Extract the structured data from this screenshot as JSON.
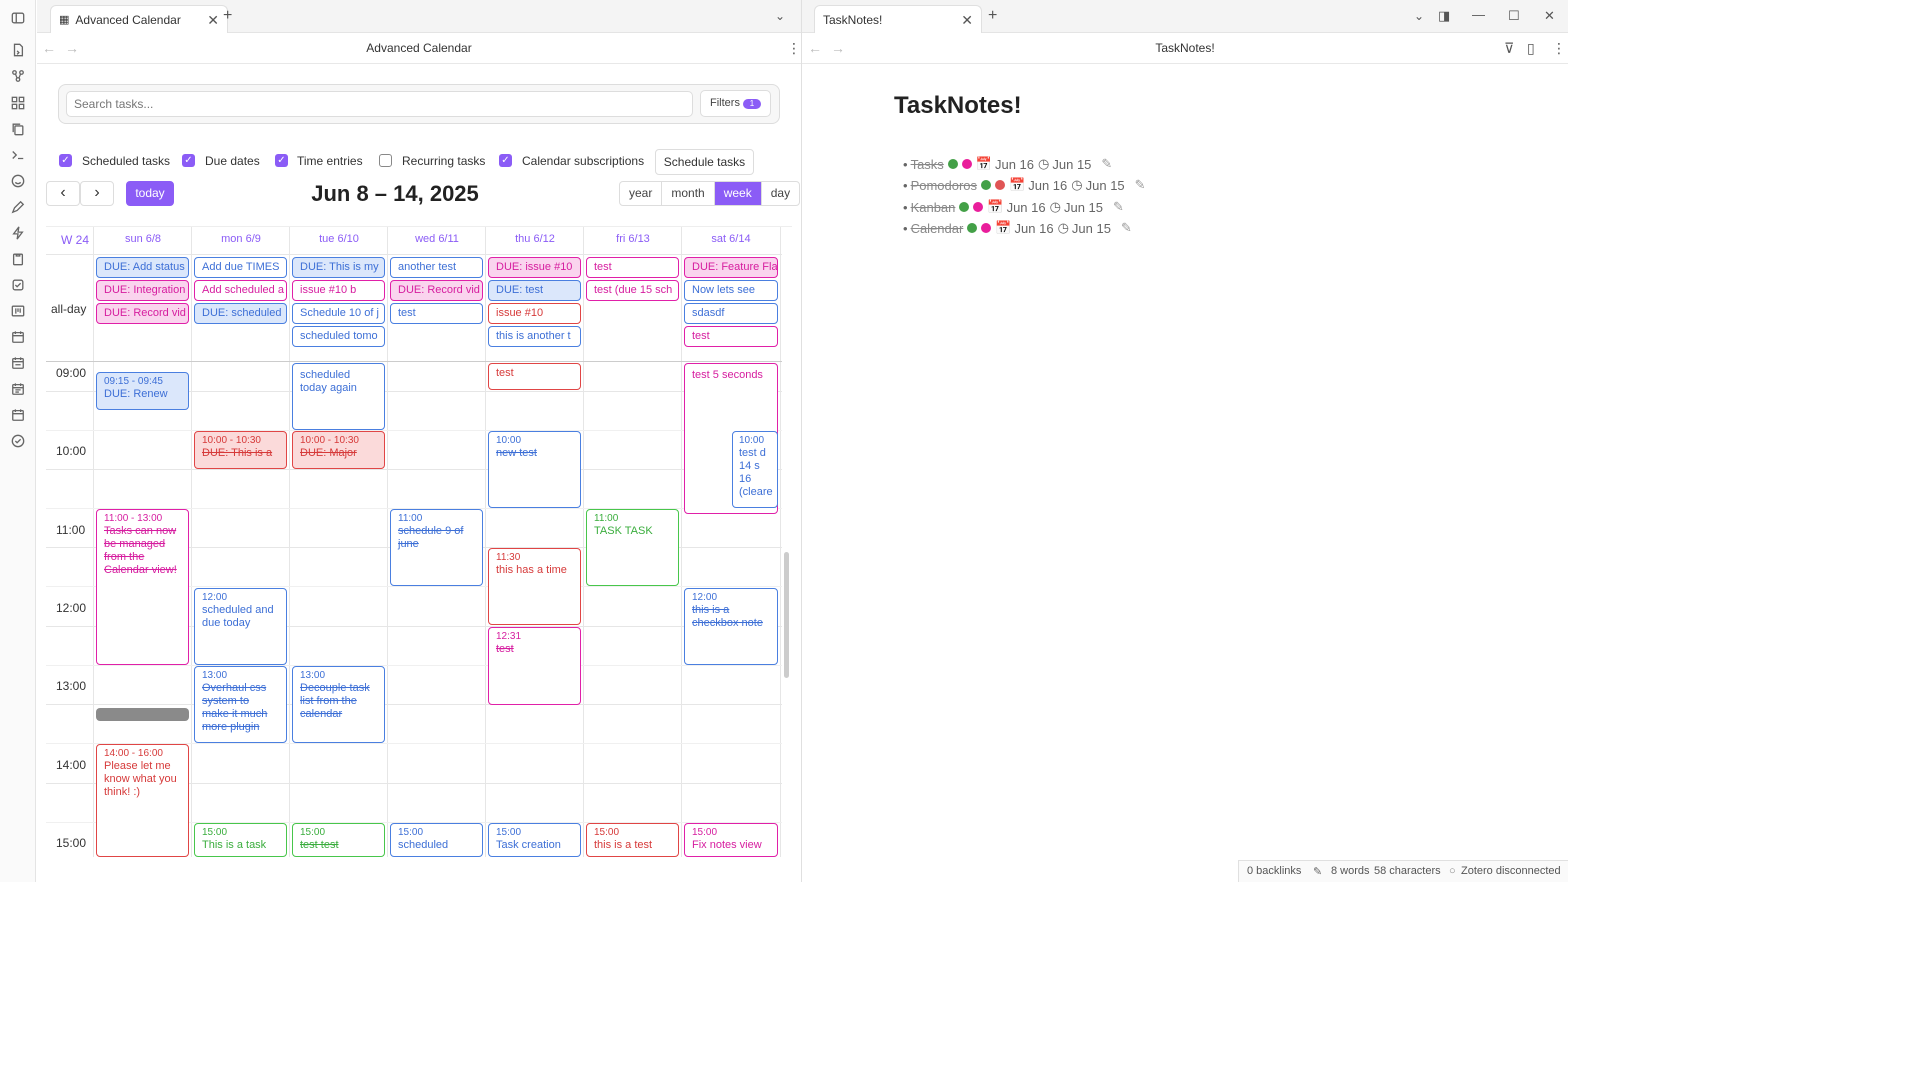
{
  "left_tab": {
    "title": "Advanced Calendar",
    "view_title": "Advanced Calendar"
  },
  "right_tab": {
    "title": "TaskNotes!",
    "view_title": "TaskNotes!"
  },
  "search": {
    "placeholder": "Search tasks..."
  },
  "filters": {
    "label": "Filters",
    "count": "1"
  },
  "toggles": [
    {
      "label": "Scheduled tasks",
      "checked": true
    },
    {
      "label": "Due dates",
      "checked": true
    },
    {
      "label": "Time entries",
      "checked": true
    },
    {
      "label": "Recurring tasks",
      "checked": false
    },
    {
      "label": "Calendar subscriptions",
      "checked": true
    }
  ],
  "schedule_button": "Schedule tasks",
  "nav": {
    "prev": "‹",
    "next": "›",
    "today": "today"
  },
  "calendar_title": "Jun 8 – 14, 2025",
  "views": [
    "year",
    "month",
    "week",
    "day"
  ],
  "active_view": "week",
  "week_label": "W 24",
  "allday_label": "all-day",
  "days": [
    "sun 6/8",
    "mon 6/9",
    "tue 6/10",
    "wed 6/11",
    "thu 6/12",
    "fri 6/13",
    "sat 6/14"
  ],
  "hours": [
    "09:00",
    "10:00",
    "11:00",
    "12:00",
    "13:00",
    "14:00",
    "15:00"
  ],
  "allday_events": [
    [
      "DUE: Add status",
      "DUE: Integration",
      "DUE: Record vid"
    ],
    [
      "Add due TIMES",
      "Add scheduled a",
      "DUE: scheduled"
    ],
    [
      "DUE: This is my",
      "issue #10 b",
      "Schedule 10 of j",
      "scheduled tomo"
    ],
    [
      "another test",
      "DUE: Record vid",
      "test"
    ],
    [
      "DUE: issue #10",
      "DUE: test",
      "issue #10",
      "this is another t"
    ],
    [
      "test",
      "test (due 15 sch"
    ],
    [
      "DUE: Feature Fla",
      "Now lets see",
      "sdasdf",
      "test"
    ]
  ],
  "events": {
    "sun_915": {
      "time": "09:15 - 09:45",
      "title": "DUE: Renew"
    },
    "sun_11": {
      "time": "11:00 - 13:00",
      "title": "Tasks can now be managed from the Calendar view!"
    },
    "sun_14": {
      "time": "14:00 - 16:00",
      "title": "Please let me know what you think! :)"
    },
    "mon_10": {
      "time": "10:00 - 10:30",
      "title": "DUE: This is a"
    },
    "mon_12": {
      "time": "12:00",
      "title": "scheduled and due today"
    },
    "mon_13": {
      "time": "13:00",
      "title": "Overhaul css system to make it much more plugin"
    },
    "mon_15": {
      "time": "15:00",
      "title": "This is a task"
    },
    "tue_9": {
      "title": "scheduled today again"
    },
    "tue_10": {
      "time": "10:00 - 10:30",
      "title": "DUE: Major"
    },
    "tue_13": {
      "time": "13:00",
      "title": "Decouple task list from the calendar"
    },
    "tue_15": {
      "time": "15:00",
      "title": "test test"
    },
    "wed_11": {
      "time": "11:00",
      "title": "schedule 9 of june"
    },
    "wed_15": {
      "time": "15:00",
      "title": "scheduled"
    },
    "thu_9": {
      "title": "test"
    },
    "thu_10": {
      "time": "10:00",
      "title": "new test"
    },
    "thu_1130": {
      "time": "11:30",
      "title": "this has a time"
    },
    "thu_1231": {
      "time": "12:31",
      "title": "test"
    },
    "thu_15": {
      "time": "15:00",
      "title": "Task creation"
    },
    "fri_11": {
      "time": "11:00",
      "title": "TASK TASK"
    },
    "fri_15": {
      "time": "15:00",
      "title": "this is a test"
    },
    "sat_9": {
      "title": "test 5 seconds"
    },
    "sat_10": {
      "time": "10:00",
      "title": "test d 14 s 16 (cleare"
    },
    "sat_12": {
      "time": "12:00",
      "title": "this is a checkbox note"
    },
    "sat_15": {
      "time": "15:00",
      "title": "Fix notes view"
    }
  },
  "note": {
    "title": "TaskNotes!",
    "tasks": [
      {
        "name": "Tasks",
        "dots": [
          "#43a047",
          "#e91e9b"
        ],
        "due": "Jun 16",
        "scheduled": "Jun 15"
      },
      {
        "name": "Pomodoros",
        "dots": [
          "#43a047",
          "#e05555"
        ],
        "due": "Jun 16",
        "scheduled": "Jun 15"
      },
      {
        "name": "Kanban",
        "dots": [
          "#43a047",
          "#e91e9b"
        ],
        "due": "Jun 16",
        "scheduled": "Jun 15"
      },
      {
        "name": "Calendar",
        "dots": [
          "#43a047",
          "#e91e9b"
        ],
        "due": "Jun 16",
        "scheduled": "Jun 15"
      }
    ]
  },
  "status": {
    "backlinks": "0 backlinks",
    "words": "8 words",
    "chars": "58 characters",
    "zotero": "Zotero disconnected"
  }
}
